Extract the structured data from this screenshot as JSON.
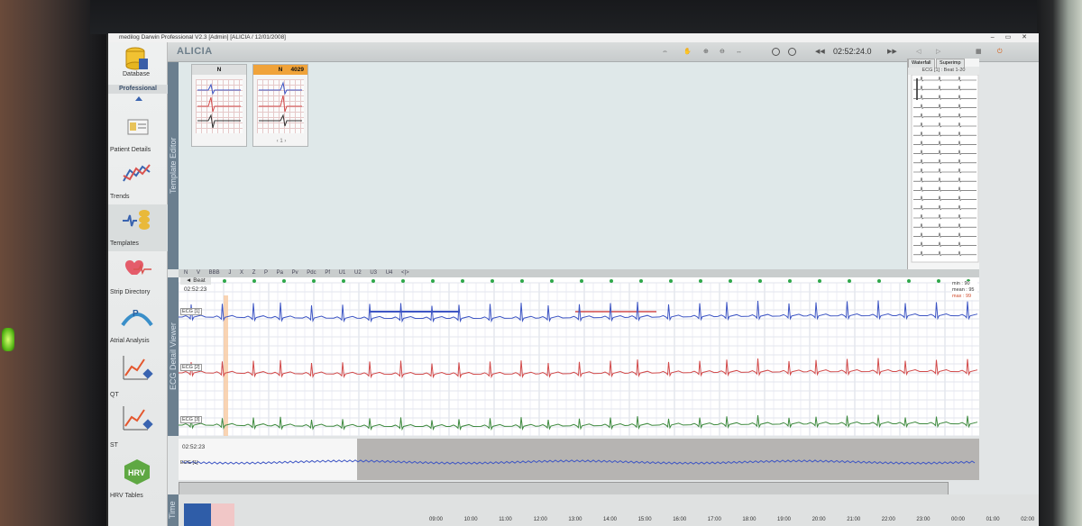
{
  "window": {
    "title": "medilog Darwin Professional V2.3 [Admin] [ALICIA / 12/01/2008]"
  },
  "toolbar": {
    "patient_name": "ALICIA",
    "time": "02:52:24.0"
  },
  "sidebar": {
    "edition": "Professional",
    "items": [
      {
        "label": "Database",
        "icon": "database-icon"
      },
      {
        "label": "Patient Details",
        "icon": "patient-card-icon"
      },
      {
        "label": "Trends",
        "icon": "trends-chart-icon"
      },
      {
        "label": "Templates",
        "icon": "templates-icon"
      },
      {
        "label": "Strip Directory",
        "icon": "heart-pulse-icon"
      },
      {
        "label": "Atrial Analysis",
        "icon": "p-wave-icon"
      },
      {
        "label": "QT",
        "icon": "qt-chart-icon"
      },
      {
        "label": "ST",
        "icon": "st-chart-icon"
      },
      {
        "label": "HRV Tables",
        "icon": "hrv-icon"
      }
    ]
  },
  "template_editor": {
    "label": "Template Editor",
    "cards": [
      {
        "class": "N",
        "count": ""
      },
      {
        "class": "N",
        "count": "4029",
        "page": "1"
      }
    ]
  },
  "waterfall": {
    "tabs": [
      "Waterfall",
      "Superimp"
    ],
    "title": "ECG [1] : Beat 1-20"
  },
  "beat_codes": [
    "N",
    "V",
    "BBB",
    "J",
    "X",
    "Z",
    "P",
    "Pa",
    "Pv",
    "Pdc",
    "Pf",
    "U1",
    "U2",
    "U3",
    "U4",
    "<|>"
  ],
  "ecg_detail": {
    "label": "ECG Detail Viewer",
    "tab": "Beat",
    "time": "02:52:23",
    "stats": {
      "min": "min : 90",
      "mean": "mean : 95",
      "max": "max : 99"
    },
    "channels": [
      {
        "label": "ECG [1]",
        "color": "#3d55c4"
      },
      {
        "label": "ECG [2]",
        "color": "#d24a4a"
      },
      {
        "label": "ECG [3]",
        "color": "#3e8a3e"
      }
    ]
  },
  "overview": {
    "time": "02:52:23",
    "channel": "ECG [1]"
  },
  "timeline": {
    "label": "Time",
    "ticks": [
      "09:00",
      "10:00",
      "11:00",
      "12:00",
      "13:00",
      "14:00",
      "15:00",
      "16:00",
      "17:00",
      "18:00",
      "19:00",
      "20:00",
      "21:00",
      "22:00",
      "23:00",
      "00:00",
      "01:00",
      "02:00"
    ]
  }
}
